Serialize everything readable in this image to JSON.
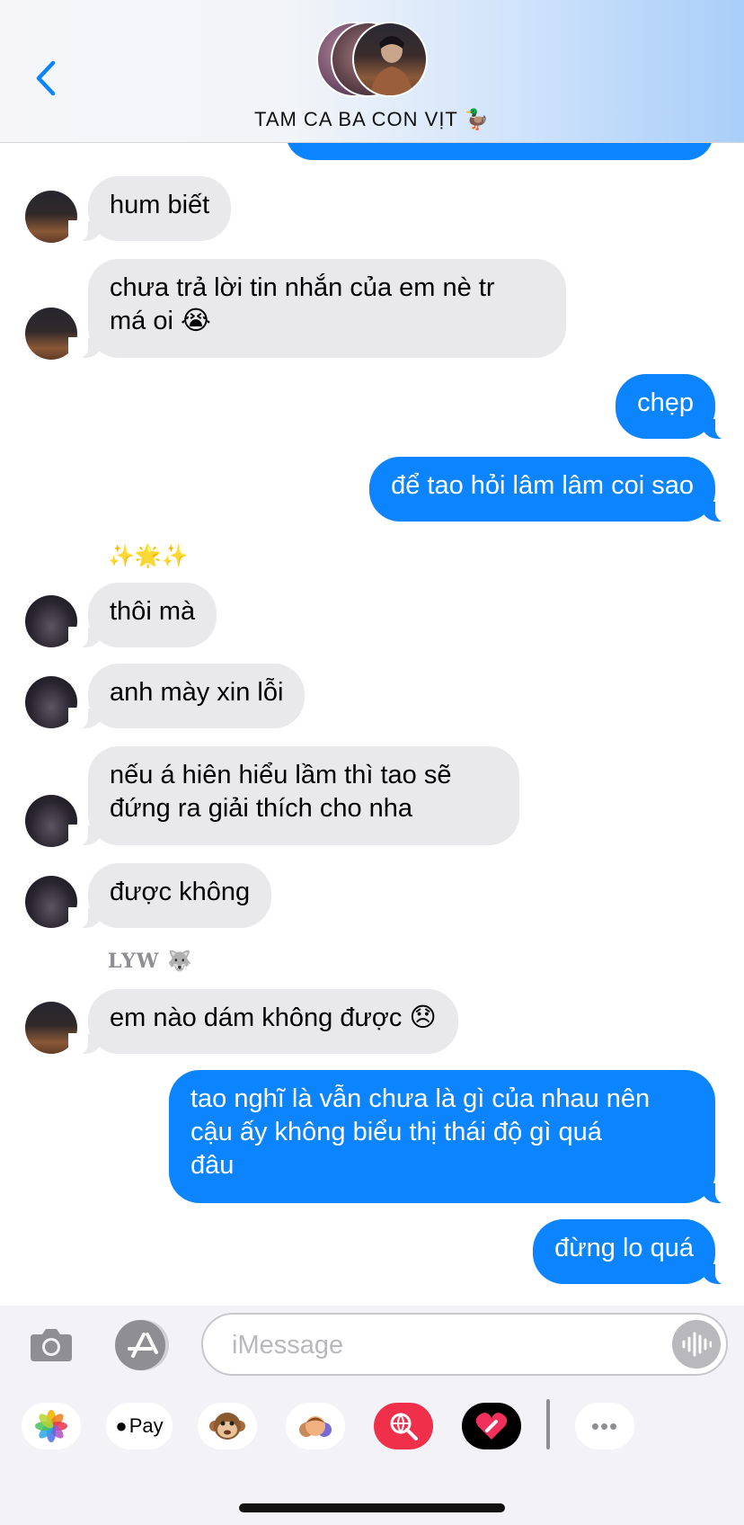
{
  "header": {
    "group_name": "TAM CA BA CON VỊT 🦆",
    "back_label": "‹"
  },
  "messages": [
    {
      "id": "m1",
      "text": "hum biết",
      "direction": "in"
    },
    {
      "id": "m2",
      "text": "chưa trả lời tin nhắn của em nè tr\nmá oi 😭",
      "direction": "in"
    },
    {
      "id": "m3",
      "text": "chẹp",
      "direction": "out"
    },
    {
      "id": "m4",
      "text": "để tao hỏi lâm lâm coi sao",
      "direction": "out"
    },
    {
      "id": "m5",
      "text": "thôi mà",
      "direction": "in",
      "sender": "✨🌟✨"
    },
    {
      "id": "m6",
      "text": "anh mày xin lỗi",
      "direction": "in"
    },
    {
      "id": "m7",
      "text": "nếu á hiên hiểu lầm thì tao sẽ\nđứng ra giải thích cho nha",
      "direction": "in"
    },
    {
      "id": "m8",
      "text": "được không",
      "direction": "in"
    },
    {
      "id": "m9",
      "text": "em nào dám không được 😞",
      "direction": "in",
      "sender": "LYW 🐺"
    },
    {
      "id": "m10",
      "text": "tao nghĩ là vẫn chưa là gì của nhau nên\ncậu ấy không biểu thị thái độ gì quá\nđâu",
      "direction": "out"
    },
    {
      "id": "m11",
      "text": "đừng lo quá",
      "direction": "out"
    }
  ],
  "senders": {
    "group1": "✨🌟✨",
    "group2": "LYW 🐺"
  },
  "input": {
    "placeholder": "iMessage",
    "value": ""
  },
  "app_drawer": {
    "apps": [
      {
        "name": "photos-app",
        "label": "🌸"
      },
      {
        "name": "apple-pay-app",
        "label": "Pay"
      },
      {
        "name": "animoji-app",
        "label": "🐵"
      },
      {
        "name": "memoji-stickers-app",
        "label": "🧒"
      },
      {
        "name": "image-search-app",
        "label": "🔍"
      },
      {
        "name": "digital-touch-app",
        "label": "❤"
      },
      {
        "name": "more-apps",
        "label": "•••"
      }
    ]
  },
  "colors": {
    "outgoing_bubble": "#0b84fe",
    "incoming_bubble": "#e9e9eb",
    "accent": "#0b84fe"
  }
}
